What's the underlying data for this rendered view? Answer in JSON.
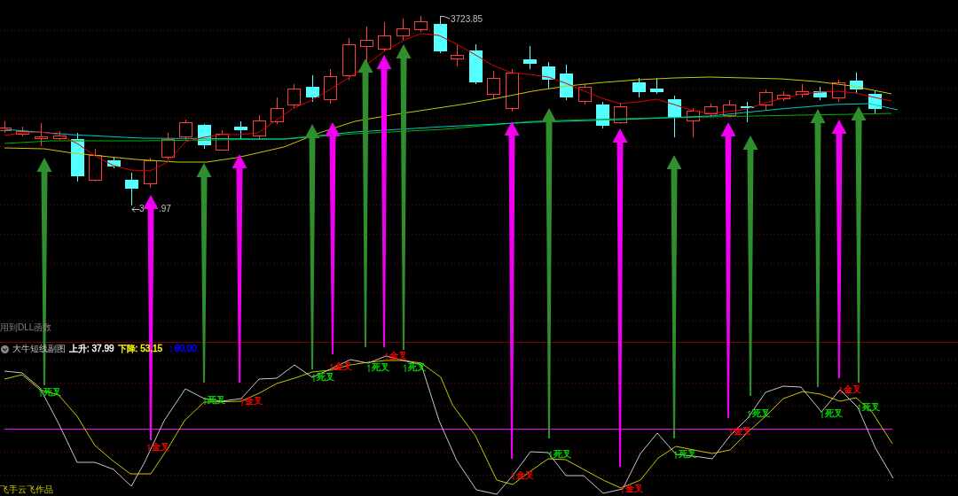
{
  "main_chart": {
    "high_label": "3723.85",
    "low_label": {
      "visible_start": "3",
      "visible_end": ".97"
    }
  },
  "dll_note": "用到DLL函数",
  "indicator_header": {
    "name": "大牛短线副图",
    "readings": [
      {
        "text": "上升: 37.99",
        "color": "#ffffff"
      },
      {
        "text": "下降: 53.15",
        "color": "#ffff00"
      },
      {
        "text": ": 60.00",
        "color": "#0000ff"
      }
    ]
  },
  "signals": [
    {
      "text": "死叉",
      "color": "#00e000"
    },
    {
      "text": "金叉",
      "color": "#ff0000"
    },
    {
      "text": "死叉",
      "color": "#00e000"
    },
    {
      "text": "金叉",
      "color": "#ff0000"
    },
    {
      "text": "死叉",
      "color": "#00e000"
    },
    {
      "text": "金叉",
      "color": "#ff0000"
    },
    {
      "text": "死叉",
      "color": "#00e000"
    },
    {
      "text": "金叉",
      "color": "#ff0000"
    },
    {
      "text": "死叉",
      "color": "#00e000"
    },
    {
      "text": "金叉",
      "color": "#ff0000"
    },
    {
      "text": "死叉",
      "color": "#00e000"
    },
    {
      "text": "金叉",
      "color": "#ff0000"
    },
    {
      "text": "死叉",
      "color": "#00e000"
    },
    {
      "text": "金叉",
      "color": "#ff0000"
    },
    {
      "text": "死叉",
      "color": "#00e000"
    },
    {
      "text": "死叉",
      "color": "#00e000"
    },
    {
      "text": "金叉",
      "color": "#ff0000"
    },
    {
      "text": "死叉",
      "color": "#00e000"
    }
  ],
  "credit": "飞手云飞作品"
}
